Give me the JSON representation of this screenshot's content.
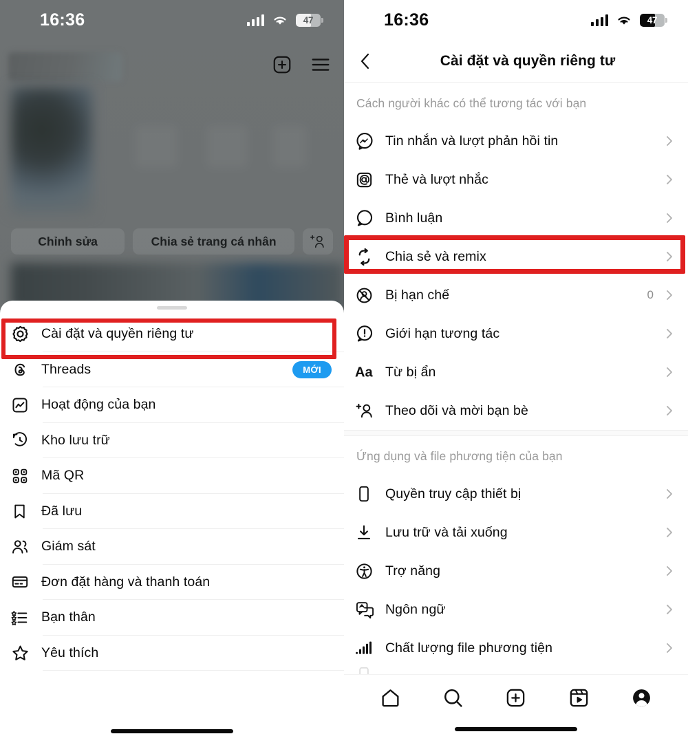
{
  "status_bar": {
    "time": "16:36",
    "battery_percent": "47",
    "signal_icon": "cellular-signal-icon",
    "wifi_icon": "wifi-icon",
    "battery_icon": "battery-icon"
  },
  "left_screen": {
    "profile": {
      "create_icon": "plus-square-icon",
      "menu_icon": "hamburger-menu-icon",
      "buttons": {
        "edit": "Chỉnh sửa",
        "share": "Chia sẻ trang cá nhân",
        "add_friend_icon": "add-person-icon"
      }
    },
    "sheet": {
      "items": [
        {
          "label": "Cài đặt và quyền riêng tư",
          "icon": "settings-gear-icon",
          "badge": "",
          "highlighted": true
        },
        {
          "label": "Threads",
          "icon": "threads-icon",
          "badge": "MỚI",
          "highlighted": false
        },
        {
          "label": "Hoạt động của bạn",
          "icon": "activity-chart-icon",
          "badge": "",
          "highlighted": false
        },
        {
          "label": "Kho lưu trữ",
          "icon": "archive-clock-icon",
          "badge": "",
          "highlighted": false
        },
        {
          "label": "Mã QR",
          "icon": "qr-code-icon",
          "badge": "",
          "highlighted": false
        },
        {
          "label": "Đã lưu",
          "icon": "bookmark-icon",
          "badge": "",
          "highlighted": false
        },
        {
          "label": "Giám sát",
          "icon": "supervision-people-icon",
          "badge": "",
          "highlighted": false
        },
        {
          "label": "Đơn đặt hàng và thanh toán",
          "icon": "credit-card-icon",
          "badge": "",
          "highlighted": false
        },
        {
          "label": "Bạn thân",
          "icon": "close-friends-list-icon",
          "badge": "",
          "highlighted": false
        },
        {
          "label": "Yêu thích",
          "icon": "star-icon",
          "badge": "",
          "highlighted": false
        }
      ]
    }
  },
  "right_screen": {
    "header": {
      "title": "Cài đặt và quyền riêng tư",
      "back_icon": "chevron-left-icon"
    },
    "sections": [
      {
        "title": "Cách người khác có thể tương tác với bạn",
        "items": [
          {
            "label": "Tin nhắn và lượt phản hồi tin",
            "icon": "messenger-icon",
            "count": "",
            "highlighted": false
          },
          {
            "label": "Thẻ và lượt nhắc",
            "icon": "at-mention-icon",
            "count": "",
            "highlighted": false
          },
          {
            "label": "Bình luận",
            "icon": "comment-bubble-icon",
            "count": "",
            "highlighted": false
          },
          {
            "label": "Chia sẻ và remix",
            "icon": "repeat-remix-icon",
            "count": "",
            "highlighted": true
          },
          {
            "label": "Bị hạn chế",
            "icon": "restricted-user-icon",
            "count": "0",
            "highlighted": false
          },
          {
            "label": "Giới hạn tương tác",
            "icon": "exclamation-bubble-icon",
            "count": "",
            "highlighted": false
          },
          {
            "label": "Từ bị ẩn",
            "icon": "hidden-words-aa-icon",
            "count": "",
            "highlighted": false
          },
          {
            "label": "Theo dõi và mời bạn bè",
            "icon": "add-person-icon",
            "count": "",
            "highlighted": false
          }
        ]
      },
      {
        "title": "Ứng dụng và file phương tiện của bạn",
        "items": [
          {
            "label": "Quyền truy cập thiết bị",
            "icon": "device-phone-icon",
            "count": "",
            "highlighted": false
          },
          {
            "label": "Lưu trữ và tải xuống",
            "icon": "download-icon",
            "count": "",
            "highlighted": false
          },
          {
            "label": "Trợ năng",
            "icon": "accessibility-icon",
            "count": "",
            "highlighted": false
          },
          {
            "label": "Ngôn ngữ",
            "icon": "language-translate-icon",
            "count": "",
            "highlighted": false
          },
          {
            "label": "Chất lượng file phương tiện",
            "icon": "media-quality-bars-icon",
            "count": "",
            "highlighted": false
          }
        ]
      }
    ],
    "tabbar": [
      {
        "icon": "home-icon",
        "name": "tab-home"
      },
      {
        "icon": "search-icon",
        "name": "tab-search"
      },
      {
        "icon": "create-plus-icon",
        "name": "tab-create"
      },
      {
        "icon": "reels-icon",
        "name": "tab-reels"
      },
      {
        "icon": "profile-avatar-icon",
        "name": "tab-profile"
      }
    ]
  },
  "colors": {
    "highlight_red": "#e02020",
    "badge_blue": "#1e9bf0",
    "muted_gray": "#9a9a9a",
    "chevron_gray": "#b0b0b0"
  }
}
